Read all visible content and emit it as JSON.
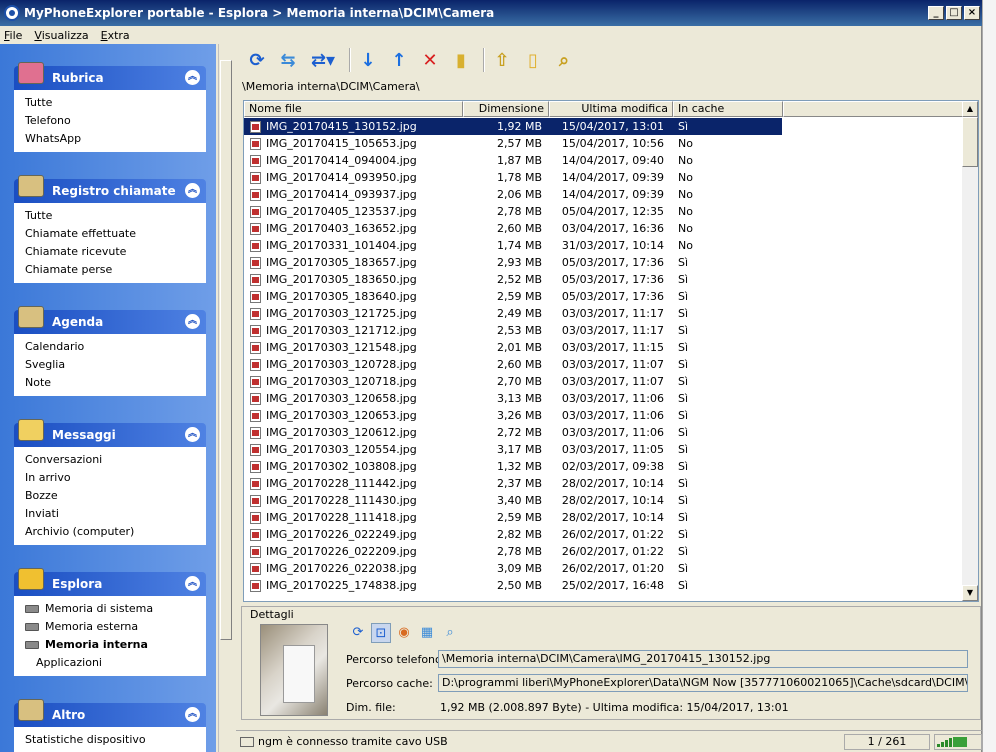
{
  "window": {
    "title": "MyPhoneExplorer portable -  Esplora > Memoria interna\\DCIM\\Camera"
  },
  "menu": [
    "File",
    "Visualizza",
    "Extra"
  ],
  "sidebar": {
    "groups": [
      {
        "title": "Rubrica",
        "icon": "address-book-icon",
        "items": [
          "Tutte",
          "Telefono",
          "WhatsApp"
        ]
      },
      {
        "title": "Registro chiamate",
        "icon": "call-log-icon",
        "items": [
          "Tutte",
          "Chiamate effettuate",
          "Chiamate ricevute",
          "Chiamate perse"
        ]
      },
      {
        "title": "Agenda",
        "icon": "calendar-icon",
        "items": [
          "Calendario",
          "Sveglia",
          "Note"
        ]
      },
      {
        "title": "Messaggi",
        "icon": "envelope-icon",
        "items": [
          "Conversazioni",
          "In arrivo",
          "Bozze",
          "Inviati",
          "Archivio (computer)"
        ]
      },
      {
        "title": "Esplora",
        "icon": "folder-icon",
        "items": [
          "Memoria di sistema",
          "Memoria esterna",
          "Memoria interna",
          "Applicazioni"
        ]
      },
      {
        "title": "Altro",
        "icon": "wrench-icon",
        "items": [
          "Statistiche dispositivo"
        ]
      }
    ]
  },
  "path": "\\Memoria interna\\DCIM\\Camera\\",
  "table": {
    "columns": [
      "Nome file",
      "Dimensione",
      "Ultima modifica",
      "In cache"
    ],
    "rows": [
      [
        "IMG_20170415_130152.jpg",
        "1,92 MB",
        "15/04/2017, 13:01",
        "Sì"
      ],
      [
        "IMG_20170415_105653.jpg",
        "2,57 MB",
        "15/04/2017, 10:56",
        "No"
      ],
      [
        "IMG_20170414_094004.jpg",
        "1,87 MB",
        "14/04/2017, 09:40",
        "No"
      ],
      [
        "IMG_20170414_093950.jpg",
        "1,78 MB",
        "14/04/2017, 09:39",
        "No"
      ],
      [
        "IMG_20170414_093937.jpg",
        "2,06 MB",
        "14/04/2017, 09:39",
        "No"
      ],
      [
        "IMG_20170405_123537.jpg",
        "2,78 MB",
        "05/04/2017, 12:35",
        "No"
      ],
      [
        "IMG_20170403_163652.jpg",
        "2,60 MB",
        "03/04/2017, 16:36",
        "No"
      ],
      [
        "IMG_20170331_101404.jpg",
        "1,74 MB",
        "31/03/2017, 10:14",
        "No"
      ],
      [
        "IMG_20170305_183657.jpg",
        "2,93 MB",
        "05/03/2017, 17:36",
        "Sì"
      ],
      [
        "IMG_20170305_183650.jpg",
        "2,52 MB",
        "05/03/2017, 17:36",
        "Sì"
      ],
      [
        "IMG_20170305_183640.jpg",
        "2,59 MB",
        "05/03/2017, 17:36",
        "Sì"
      ],
      [
        "IMG_20170303_121725.jpg",
        "2,49 MB",
        "03/03/2017, 11:17",
        "Sì"
      ],
      [
        "IMG_20170303_121712.jpg",
        "2,53 MB",
        "03/03/2017, 11:17",
        "Sì"
      ],
      [
        "IMG_20170303_121548.jpg",
        "2,01 MB",
        "03/03/2017, 11:15",
        "Sì"
      ],
      [
        "IMG_20170303_120728.jpg",
        "2,60 MB",
        "03/03/2017, 11:07",
        "Sì"
      ],
      [
        "IMG_20170303_120718.jpg",
        "2,70 MB",
        "03/03/2017, 11:07",
        "Sì"
      ],
      [
        "IMG_20170303_120658.jpg",
        "3,13 MB",
        "03/03/2017, 11:06",
        "Sì"
      ],
      [
        "IMG_20170303_120653.jpg",
        "3,26 MB",
        "03/03/2017, 11:06",
        "Sì"
      ],
      [
        "IMG_20170303_120612.jpg",
        "2,72 MB",
        "03/03/2017, 11:06",
        "Sì"
      ],
      [
        "IMG_20170303_120554.jpg",
        "3,17 MB",
        "03/03/2017, 11:05",
        "Sì"
      ],
      [
        "IMG_20170302_103808.jpg",
        "1,32 MB",
        "02/03/2017, 09:38",
        "Sì"
      ],
      [
        "IMG_20170228_111442.jpg",
        "2,37 MB",
        "28/02/2017, 10:14",
        "Sì"
      ],
      [
        "IMG_20170228_111430.jpg",
        "3,40 MB",
        "28/02/2017, 10:14",
        "Sì"
      ],
      [
        "IMG_20170228_111418.jpg",
        "2,59 MB",
        "28/02/2017, 10:14",
        "Sì"
      ],
      [
        "IMG_20170226_022249.jpg",
        "2,82 MB",
        "26/02/2017, 01:22",
        "Sì"
      ],
      [
        "IMG_20170226_022209.jpg",
        "2,78 MB",
        "26/02/2017, 01:22",
        "Sì"
      ],
      [
        "IMG_20170226_022038.jpg",
        "3,09 MB",
        "26/02/2017, 01:20",
        "Sì"
      ],
      [
        "IMG_20170225_174838.jpg",
        "2,50 MB",
        "25/02/2017, 16:48",
        "Sì"
      ]
    ]
  },
  "details": {
    "title": "Dettagli",
    "phone_path_label": "Percorso telefono:",
    "phone_path": "\\Memoria interna\\DCIM\\Camera\\IMG_20170415_130152.jpg",
    "cache_path_label": "Percorso cache:",
    "cache_path": "D:\\programmi liberi\\MyPhoneExplorer\\Data\\NGM Now [357771060021065]\\Cache\\sdcard\\DCIM\\Camera\\IMG_",
    "size_label": "Dim. file:",
    "size_value": "1,92 MB (2.008.897 Byte) - Ultima modifica: 15/04/2017, 13:01"
  },
  "status": {
    "message": "ngm è connesso tramite cavo USB",
    "count": "1 / 261"
  },
  "colors": {
    "selection": "#0a246a",
    "sidebar": "#3b78d8"
  }
}
